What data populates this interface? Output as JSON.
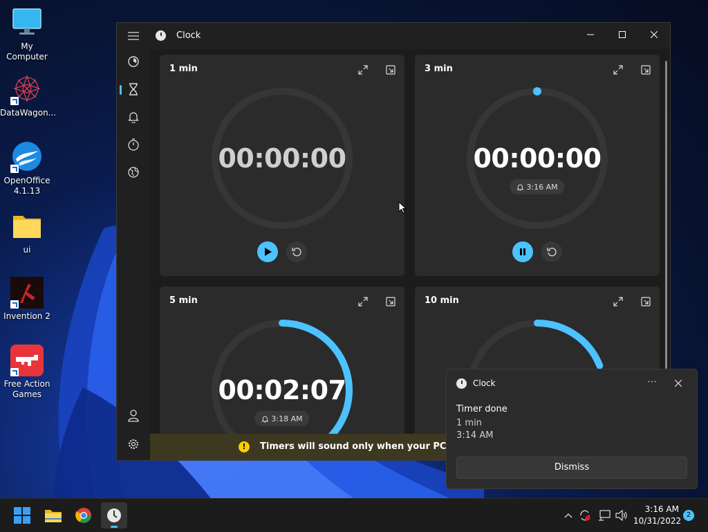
{
  "desktop": {
    "icons": [
      {
        "label": "My Computer"
      },
      {
        "label": "DataWagon..."
      },
      {
        "label": "OpenOffice 4.1.13"
      },
      {
        "label": "ui"
      },
      {
        "label": "Invention 2"
      },
      {
        "label": "Free Action Games"
      }
    ]
  },
  "window": {
    "title": "Clock",
    "nav": [
      "focus-sessions",
      "timer",
      "alarm",
      "stopwatch",
      "world-clock"
    ],
    "selected_nav": "timer"
  },
  "timers": [
    {
      "name": "1 min",
      "time": "00:00:00",
      "alarm": "",
      "state": "stopped",
      "progress": 0
    },
    {
      "name": "3 min",
      "time": "00:00:00",
      "alarm": "3:16 AM",
      "state": "running",
      "progress": 0
    },
    {
      "name": "5 min",
      "time": "00:02:07",
      "alarm": "3:18 AM",
      "state": "running",
      "progress": 0.42
    },
    {
      "name": "10 min",
      "time": "",
      "alarm": "",
      "state": "running",
      "progress": 0.19
    }
  ],
  "banner": {
    "text": "Timers will sound only when your PC is awake"
  },
  "toast": {
    "app": "Clock",
    "title": "Timer done",
    "line1": "1 min",
    "line2": "3:14 AM",
    "button": "Dismiss"
  },
  "taskbar": {
    "time": "3:16 AM",
    "date": "10/31/2022",
    "notification_count": "2"
  },
  "colors": {
    "accent": "#4cc2ff",
    "ring_track": "#363636",
    "warning": "#ffcc00"
  }
}
